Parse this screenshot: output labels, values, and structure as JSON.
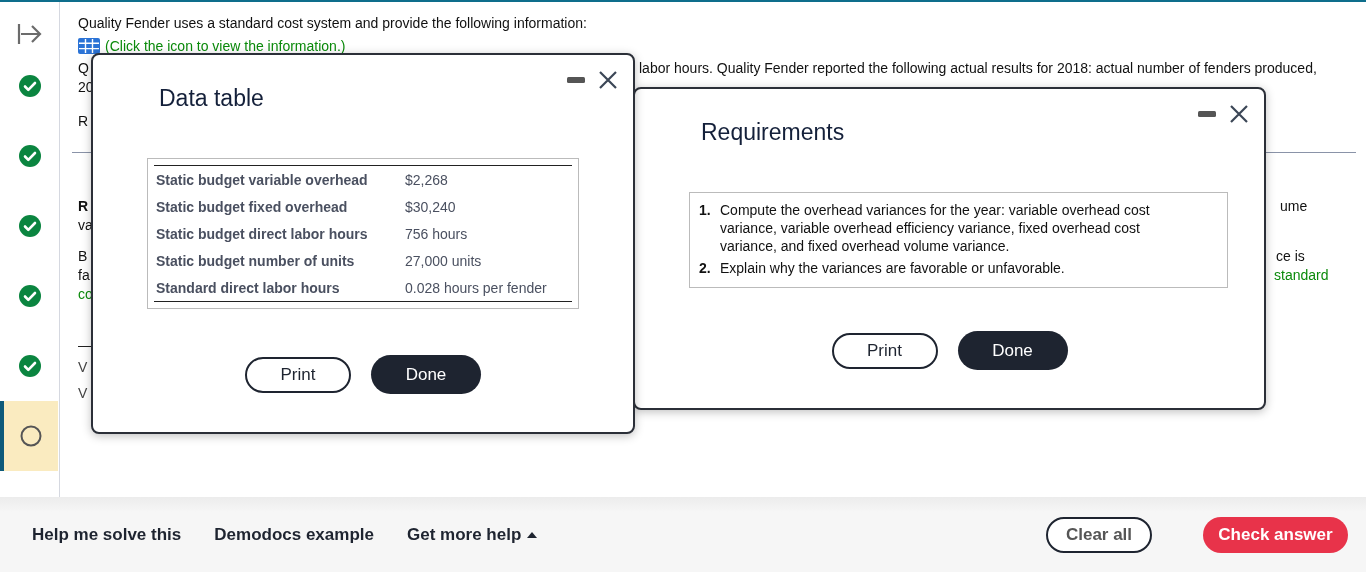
{
  "sidebar": {
    "items": [
      {
        "kind": "done",
        "selected": false
      },
      {
        "kind": "done",
        "selected": false
      },
      {
        "kind": "done",
        "selected": false
      },
      {
        "kind": "done",
        "selected": false
      },
      {
        "kind": "done",
        "selected": false
      },
      {
        "kind": "pending",
        "selected": true
      }
    ]
  },
  "question": {
    "intro": "Quality Fender uses a standard cost system and provide the following information:",
    "link": "(Click the icon to view the information.)",
    "paragraphs": [
      [
        {
          "left": {
            "text": "Q",
            "kind": "text"
          },
          "right": {
            "text": "labor hours. Quality Fender reported the following actual results for 2018: actual number of fenders produced,",
            "kind": "text"
          }
        },
        {
          "left": {
            "text": "20",
            "kind": "text"
          }
        }
      ],
      [
        {
          "left": {
            "text": "R",
            "kind": "text"
          }
        }
      ],
      [
        {
          "left": {
            "text": "R",
            "kind": "heading"
          },
          "right": {
            "text": "ume",
            "kind": "text"
          }
        },
        {
          "left": {
            "text": "va",
            "kind": "text"
          }
        }
      ],
      [
        {
          "left": {
            "text": "B",
            "kind": "text"
          },
          "right": {
            "text": "ce is",
            "kind": "text"
          }
        },
        {
          "left": {
            "text": "fa",
            "kind": "text"
          },
          "right": {
            "text": "standard",
            "kind": "link"
          }
        },
        {
          "left": {
            "text": "co",
            "kind": "link"
          }
        }
      ],
      [
        {
          "left": {
            "text": "V",
            "kind": "muted"
          }
        },
        {
          "left": {
            "text": "V",
            "kind": "muted"
          }
        }
      ]
    ]
  },
  "dialogs": [
    {
      "kind": "table",
      "title": "Data table",
      "rows": [
        {
          "label": "Static budget variable overhead",
          "value": "$2,268"
        },
        {
          "label": "Static budget fixed overhead",
          "value": "$30,240"
        },
        {
          "label": "Static budget direct labor hours",
          "value": "756 hours"
        },
        {
          "label": "Static budget number of units",
          "value": "27,000 units"
        },
        {
          "label": "Standard direct labor hours",
          "value": "0.028 hours per fender"
        }
      ],
      "buttons": [
        {
          "label": "Print",
          "kind": "secondary"
        },
        {
          "label": "Done",
          "kind": "primary"
        }
      ]
    },
    {
      "kind": "list",
      "title": "Requirements",
      "items": [
        {
          "number": "1.",
          "text": "Compute the overhead variances for the year: variable overhead cost variance, variable overhead efficiency variance, fixed overhead cost variance, and fixed overhead volume variance."
        },
        {
          "number": "2.",
          "text": "Explain why the variances are favorable or unfavorable."
        }
      ],
      "buttons": [
        {
          "label": "Print",
          "kind": "secondary"
        },
        {
          "label": "Done",
          "kind": "primary"
        }
      ]
    }
  ],
  "help_bar": {
    "links": [
      "Help me solve this",
      "Demodocs example",
      "Get more help"
    ],
    "buttons": [
      {
        "label": "Clear all",
        "kind": "secondary"
      },
      {
        "label": "Check answer",
        "kind": "primary"
      }
    ]
  }
}
